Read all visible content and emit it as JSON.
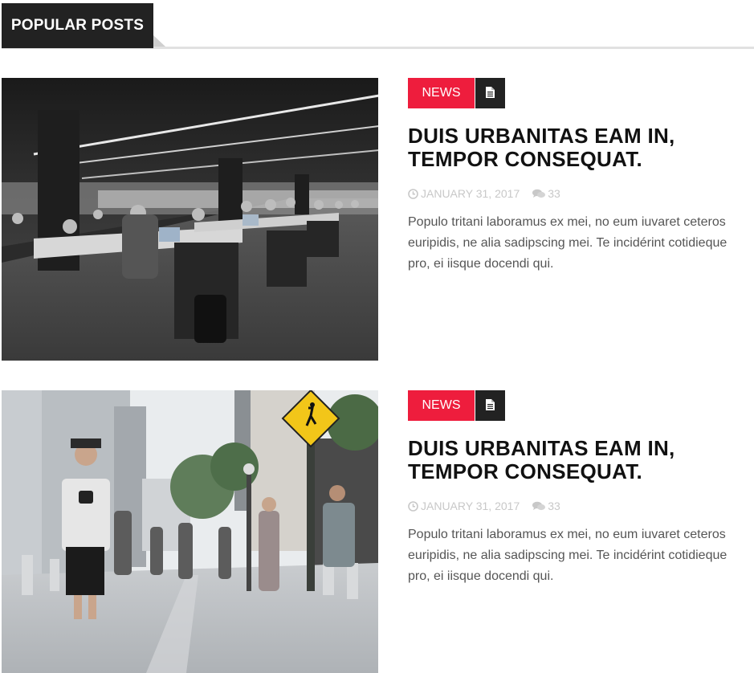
{
  "section": {
    "title": "POPULAR POSTS"
  },
  "posts": [
    {
      "category": "NEWS",
      "format_icon": "document-icon",
      "title": "DUIS URBANITAS EAM IN, TEMPOR CONSEQUAT.",
      "date": "JANUARY 31, 2017",
      "comments": "33",
      "excerpt": "Populo tritani laboramus ex mei, no eum iuvaret ceteros euripidis, ne alia sadipscing mei. Te incidérint cotidieque pro, ei iisque docendi qui.",
      "image": "office-coworking-photo"
    },
    {
      "category": "NEWS",
      "format_icon": "document-icon",
      "title": "DUIS URBANITAS EAM IN, TEMPOR CONSEQUAT.",
      "date": "JANUARY 31, 2017",
      "comments": "33",
      "excerpt": "Populo tritani laboramus ex mei, no eum iuvaret ceteros euripidis, ne alia sadipscing mei. Te incidérint cotidieque pro, ei iisque docendi qui.",
      "image": "street-photographer-photo"
    }
  ],
  "colors": {
    "accent": "#ee1d3d",
    "dark": "#222222",
    "meta": "#c8c8c8",
    "text": "#555555"
  }
}
